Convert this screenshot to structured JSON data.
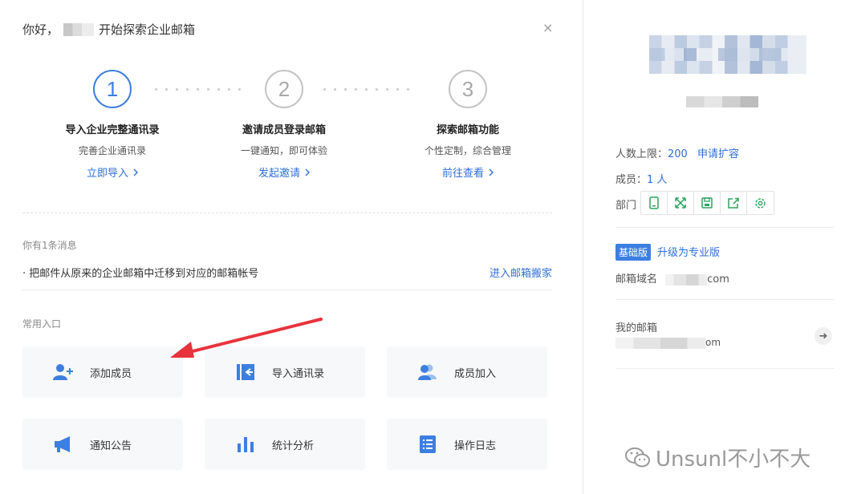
{
  "greeting": {
    "prefix": "你好，",
    "suffix": "开始探索企业邮箱"
  },
  "close_glyph": "×",
  "steps": [
    {
      "num": "1",
      "title": "导入企业完整通讯录",
      "desc": "完善企业通讯录",
      "link": "立即导入",
      "active": true
    },
    {
      "num": "2",
      "title": "邀请成员登录邮箱",
      "desc": "一键通知，即可体验",
      "link": "发起邀请",
      "active": false
    },
    {
      "num": "3",
      "title": "探索邮箱功能",
      "desc": "个性定制，综合管理",
      "link": "前往查看",
      "active": false
    }
  ],
  "messages": {
    "label": "你有1条消息",
    "item": "· 把邮件从原来的企业邮箱中迁移到对应的邮箱帐号",
    "action": "进入邮箱搬家"
  },
  "shortcuts": {
    "label": "常用入口",
    "items": [
      {
        "label": "添加成员",
        "icon": "add-user-icon"
      },
      {
        "label": "导入通讯录",
        "icon": "import-contacts-icon"
      },
      {
        "label": "成员加入",
        "icon": "members-join-icon"
      },
      {
        "label": "通知公告",
        "icon": "announcement-icon"
      },
      {
        "label": "统计分析",
        "icon": "statistics-icon"
      },
      {
        "label": "操作日志",
        "icon": "log-icon"
      }
    ]
  },
  "right": {
    "quota_label": "人数上限：",
    "quota_value": "200",
    "quota_action": "申请扩容",
    "members_label": "成员：",
    "members_value": "1 人",
    "dept_label": "部门",
    "dept_tools": [
      "phone-icon",
      "expand-icon",
      "save-icon",
      "share-icon",
      "settings-icon"
    ],
    "edition_badge": "基础版",
    "upgrade_link": "升级为专业版",
    "domain_label": "邮箱域名",
    "domain_suffix": "com",
    "my_mailbox_label": "我的邮箱",
    "my_mailbox_suffix": "om"
  },
  "watermark": "Unsunl不小不大",
  "colors": {
    "accent": "#3d7fe0",
    "link": "#2f6fd8",
    "arrow": "#e8323c"
  }
}
